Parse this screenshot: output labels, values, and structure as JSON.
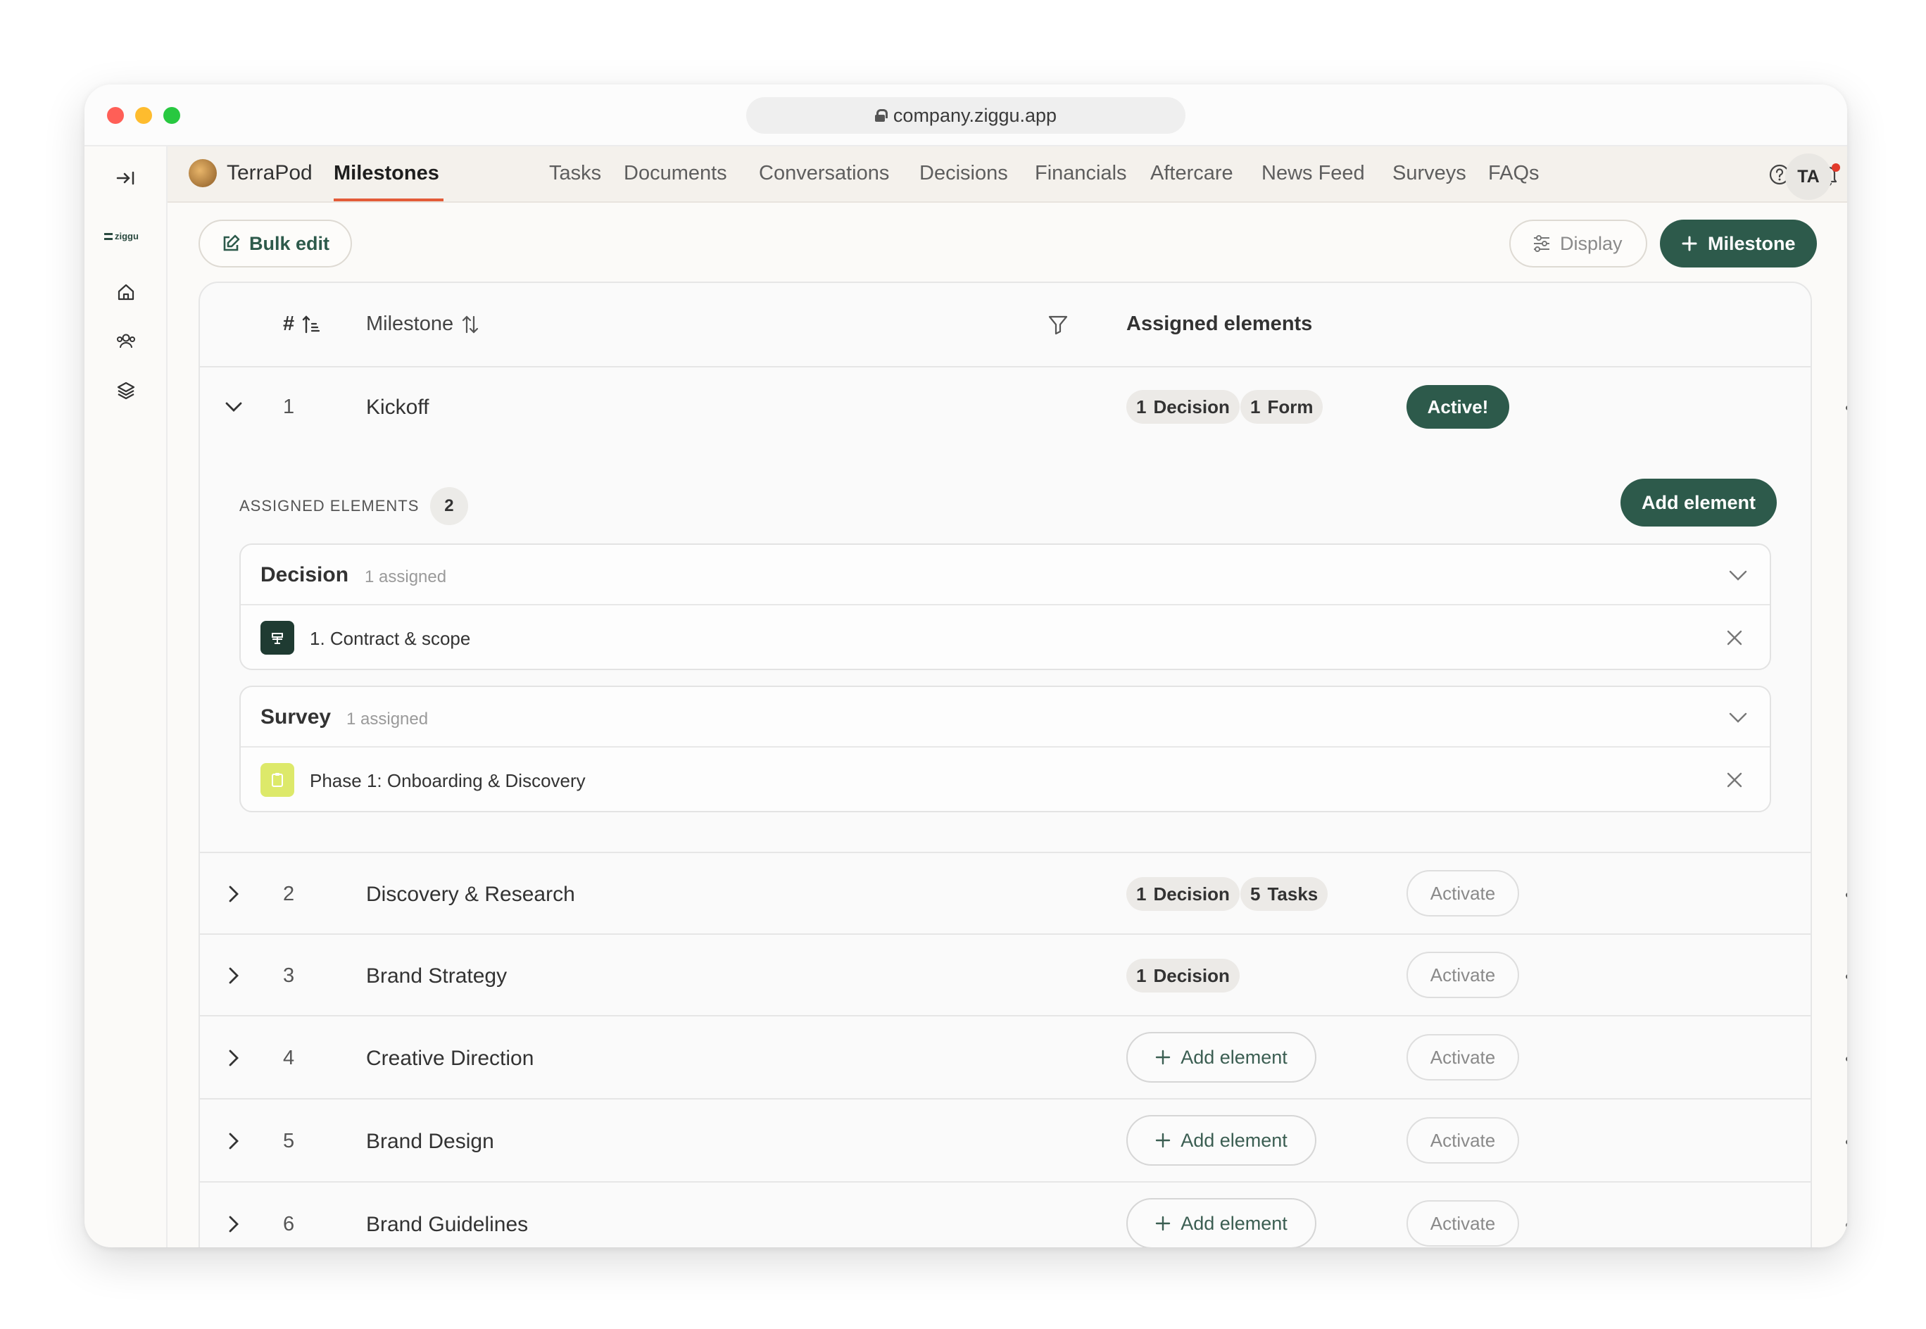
{
  "browser": {
    "url": "company.ziggu.app"
  },
  "sidebar": {
    "logo_text": "ziggu"
  },
  "brand": {
    "name": "TerraPod"
  },
  "nav": {
    "items": [
      {
        "label": "Milestones",
        "active": true
      },
      {
        "label": "Tasks"
      },
      {
        "label": "Documents"
      },
      {
        "label": "Conversations"
      },
      {
        "label": "Decisions"
      },
      {
        "label": "Financials"
      },
      {
        "label": "Aftercare"
      },
      {
        "label": "News Feed"
      },
      {
        "label": "Surveys"
      },
      {
        "label": "FAQs"
      }
    ],
    "avatar": "TA"
  },
  "toolbar": {
    "bulk_edit": "Bulk edit",
    "display": "Display",
    "add_milestone": "Milestone"
  },
  "table": {
    "headers": {
      "number": "#",
      "milestone": "Milestone",
      "assigned": "Assigned elements"
    },
    "rows": [
      {
        "num": "1",
        "name": "Kickoff",
        "chips": [
          {
            "n": "1",
            "label": "Decision"
          },
          {
            "n": "1",
            "label": "Form"
          }
        ],
        "status": "Active!"
      },
      {
        "num": "2",
        "name": "Discovery & Research",
        "chips": [
          {
            "n": "1",
            "label": "Decision"
          },
          {
            "n": "5",
            "label": "Tasks"
          }
        ],
        "status": "Activate"
      },
      {
        "num": "3",
        "name": "Brand Strategy",
        "chips": [
          {
            "n": "1",
            "label": "Decision"
          }
        ],
        "status": "Activate"
      },
      {
        "num": "4",
        "name": "Creative Direction",
        "add_label": "Add element",
        "status": "Activate"
      },
      {
        "num": "5",
        "name": "Brand Design",
        "add_label": "Add element",
        "status": "Activate"
      },
      {
        "num": "6",
        "name": "Brand Guidelines",
        "add_label": "Add element",
        "status": "Activate"
      }
    ]
  },
  "expanded": {
    "title": "ASSIGNED ELEMENTS",
    "count": "2",
    "add_button": "Add element",
    "groups": [
      {
        "title": "Decision",
        "sub": "1 assigned",
        "item": "1. Contract & scope"
      },
      {
        "title": "Survey",
        "sub": "1 assigned",
        "item": "Phase 1: Onboarding & Discovery"
      }
    ]
  },
  "colors": {
    "accent_green": "#2d5a4b",
    "nav_underline": "#e35b38",
    "survey_icon": "#dde96a"
  }
}
